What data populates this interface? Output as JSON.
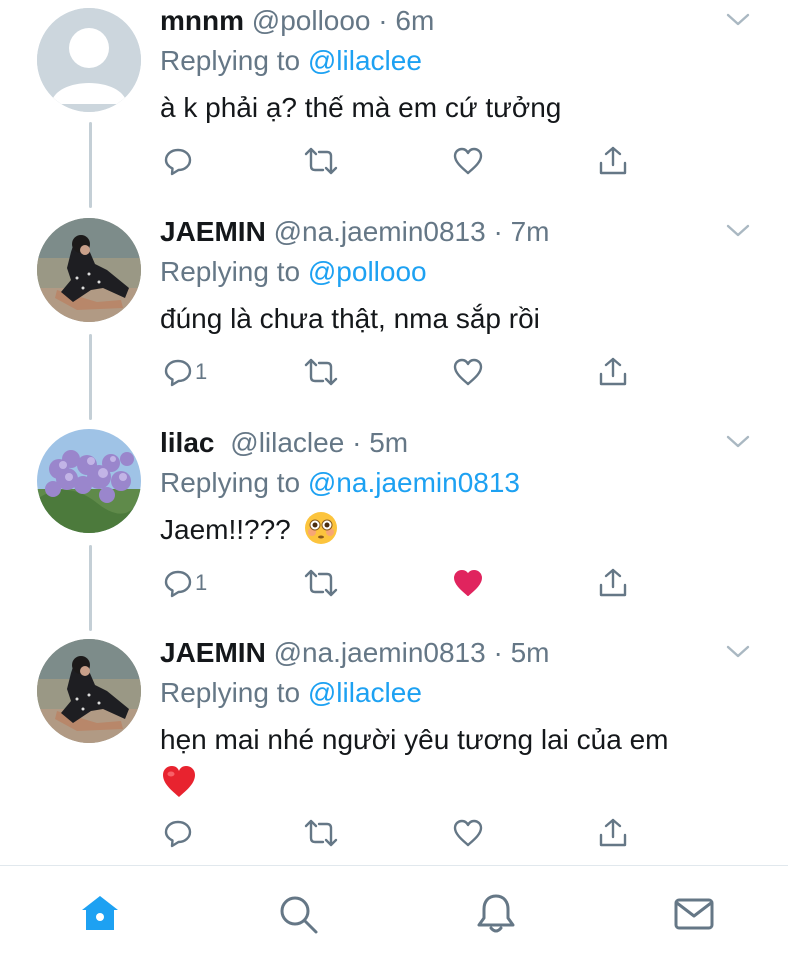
{
  "tweets": [
    {
      "name": "mnnm",
      "handle": "@pollooo",
      "time": "6m",
      "replying_prefix": "Replying to ",
      "replying_to": "@lilaclee",
      "text": "à k phải ạ? thế mà em cứ tưởng",
      "reply_count": "",
      "liked": false,
      "avatar": "default-avatar"
    },
    {
      "name": "JAEMIN",
      "handle": "@na.jaemin0813",
      "time": "7m",
      "replying_prefix": "Replying to ",
      "replying_to": "@pollooo",
      "text": "đúng là chưa thật, nma sắp rồi",
      "reply_count": "1",
      "liked": false,
      "avatar": "person-photo"
    },
    {
      "name": "lilac",
      "handle": "@lilaclee",
      "time": "5m",
      "replying_prefix": "Replying to ",
      "replying_to": "@na.jaemin0813",
      "text": "Jaem!!???",
      "emoji": "flushed-face",
      "reply_count": "1",
      "liked": true,
      "avatar": "lilac-flowers-photo"
    },
    {
      "name": "JAEMIN",
      "handle": "@na.jaemin0813",
      "time": "5m",
      "replying_prefix": "Replying to ",
      "replying_to": "@lilaclee",
      "text": "hẹn mai nhé người yêu tương lai của em",
      "emoji": "red-heart",
      "reply_count": "",
      "liked": false,
      "avatar": "person-photo"
    }
  ],
  "separator": " · ",
  "tabbar": {
    "tabs": [
      "home-icon",
      "search-icon",
      "notifications-icon",
      "messages-icon"
    ],
    "active": "home-icon"
  },
  "colors": {
    "accent": "#1da1f2",
    "secondary_text": "#657786",
    "like_red": "#e0245e",
    "thread_line": "#c4cfd6"
  }
}
